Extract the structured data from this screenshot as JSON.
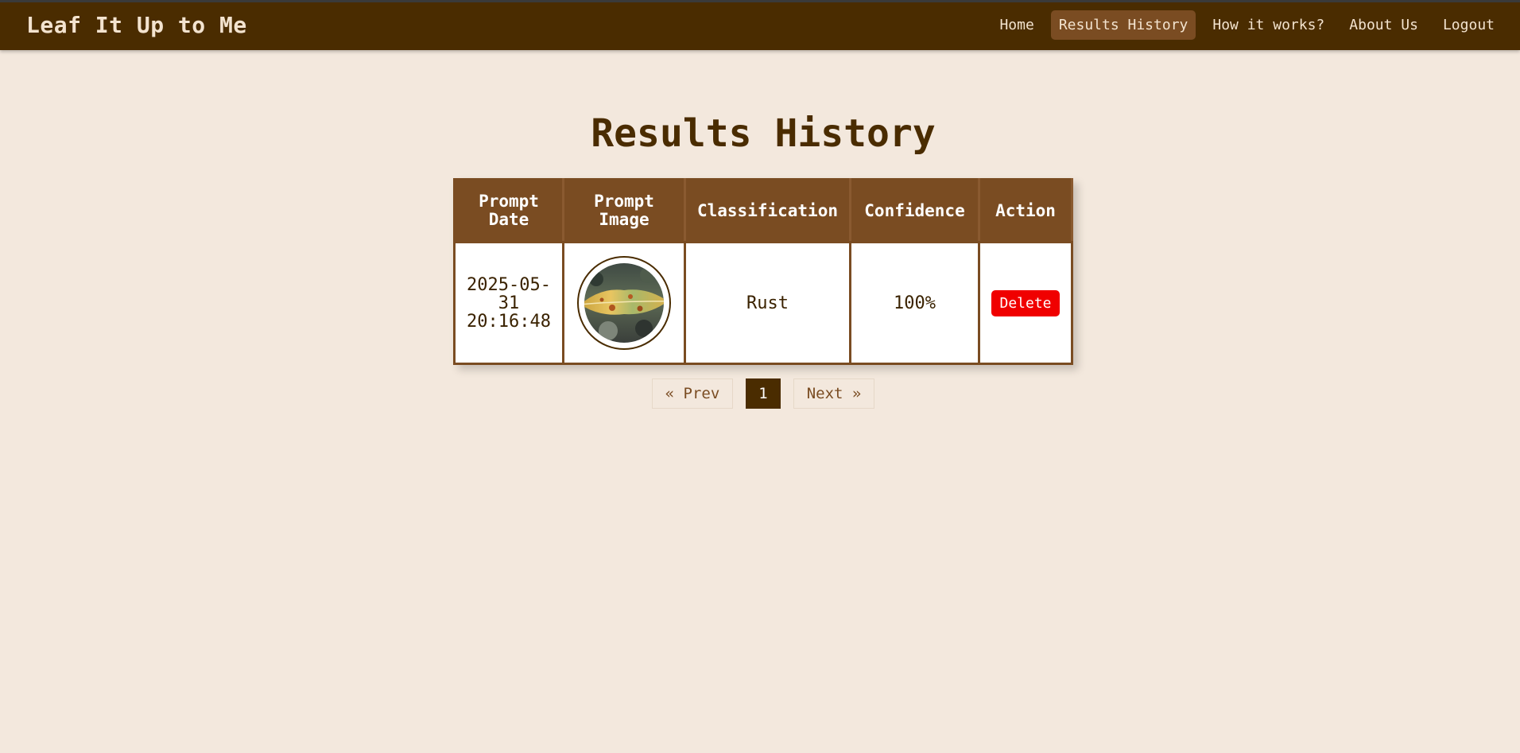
{
  "app": {
    "brand": "Leaf It Up to Me"
  },
  "nav": {
    "items": [
      {
        "label": "Home",
        "active": false
      },
      {
        "label": "Results History",
        "active": true
      },
      {
        "label": "How it works?",
        "active": false
      },
      {
        "label": "About Us",
        "active": false
      },
      {
        "label": "Logout",
        "active": false
      }
    ]
  },
  "page": {
    "title": "Results History"
  },
  "table": {
    "headers": [
      "Prompt Date",
      "Prompt Image",
      "Classification",
      "Confidence",
      "Action"
    ],
    "rows": [
      {
        "date": "2025-05-31 20:16:48",
        "image_icon": "leaf-thumbnail",
        "classification": "Rust",
        "confidence": "100%",
        "action_label": "Delete"
      }
    ]
  },
  "pagination": {
    "prev_label": "« Prev",
    "current_page": "1",
    "next_label": "Next »"
  },
  "colors": {
    "navbar": "#4a2c00",
    "header": "#7a4c22",
    "background": "#f3e8dd",
    "delete": "#f00000"
  }
}
